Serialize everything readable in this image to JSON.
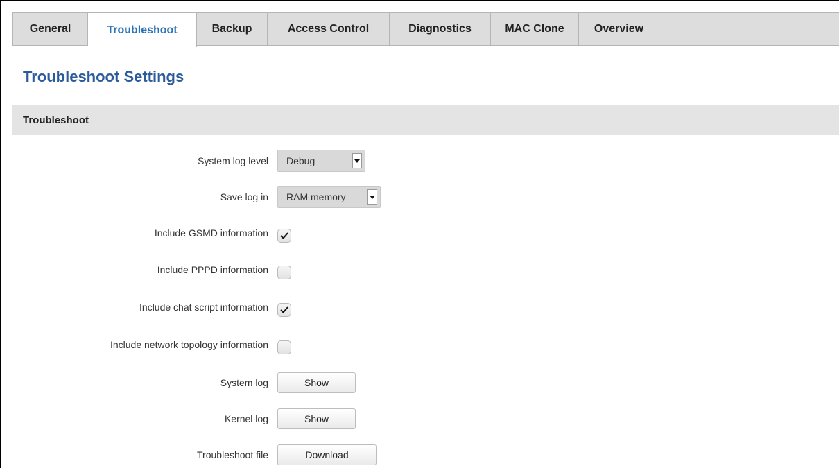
{
  "tabs": [
    {
      "label": "General",
      "active": false
    },
    {
      "label": "Troubleshoot",
      "active": true
    },
    {
      "label": "Backup",
      "active": false
    },
    {
      "label": "Access Control",
      "active": false
    },
    {
      "label": "Diagnostics",
      "active": false
    },
    {
      "label": "MAC Clone",
      "active": false
    },
    {
      "label": "Overview",
      "active": false
    }
  ],
  "page_title": "Troubleshoot Settings",
  "section_title": "Troubleshoot",
  "fields": {
    "system_log_level": {
      "label": "System log level",
      "value": "Debug"
    },
    "save_log_in": {
      "label": "Save log in",
      "value": "RAM memory"
    },
    "include_gsmd": {
      "label": "Include GSMD information",
      "checked": true
    },
    "include_pppd": {
      "label": "Include PPPD information",
      "checked": false
    },
    "include_chat_script": {
      "label": "Include chat script information",
      "checked": true
    },
    "include_network_topology": {
      "label": "Include network topology information",
      "checked": false
    },
    "system_log": {
      "label": "System log",
      "button": "Show"
    },
    "kernel_log": {
      "label": "Kernel log",
      "button": "Show"
    },
    "troubleshoot_file": {
      "label": "Troubleshoot file",
      "button": "Download"
    }
  },
  "colors": {
    "accent": "#2b73b6",
    "title": "#2b5b9b",
    "tabbar_bg": "#dddddd",
    "section_bg": "#e4e4e4"
  }
}
